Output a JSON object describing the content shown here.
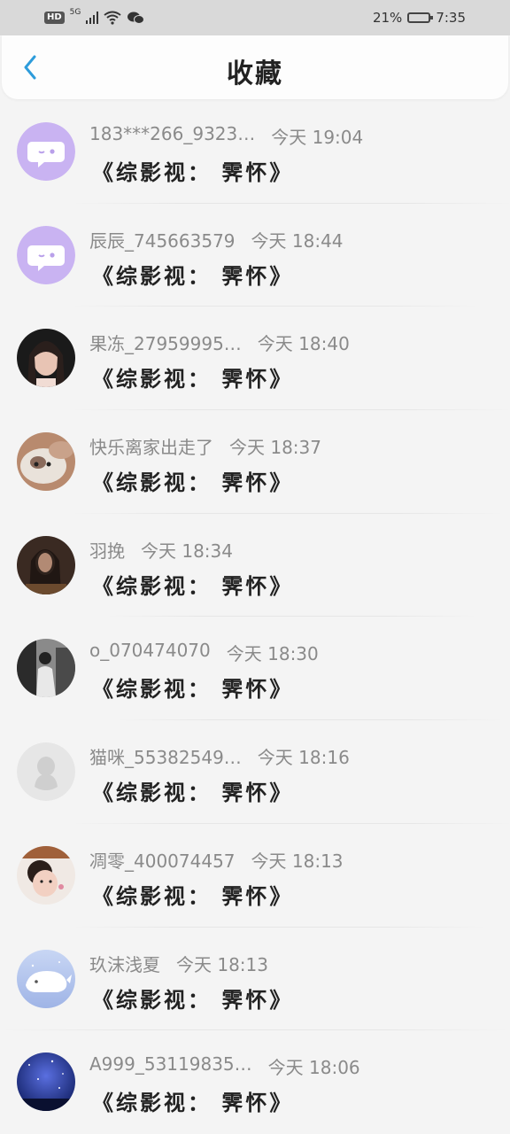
{
  "status_bar": {
    "hd": "HD",
    "network": "5G",
    "battery_percent": "21%",
    "time": "7:35",
    "battery_level": 0.21
  },
  "header": {
    "back_icon": "chevron-left-icon",
    "title": "收藏"
  },
  "colors": {
    "accent": "#2d9cdb",
    "purple_avatar": "#c9b3f2"
  },
  "items": [
    {
      "name": "183***266_9323…",
      "time": "今天 19:04",
      "content": "《综影视： 霁怀》",
      "avatar": "purple-chat-avatar"
    },
    {
      "name": "辰辰_745663579",
      "time": "今天 18:44",
      "content": "《综影视： 霁怀》",
      "avatar": "purple-chat-avatar"
    },
    {
      "name": "果冻_27959995…",
      "time": "今天 18:40",
      "content": "《综影视： 霁怀》",
      "avatar": "girl-portrait-avatar"
    },
    {
      "name": "快乐离家出走了",
      "time": "今天 18:37",
      "content": "《综影视： 霁怀》",
      "avatar": "kitten-avatar"
    },
    {
      "name": "羽挽",
      "time": "今天 18:34",
      "content": "《综影视： 霁怀》",
      "avatar": "dark-portrait-avatar"
    },
    {
      "name": "o_070474070",
      "time": "今天 18:30",
      "content": "《综影视： 霁怀》",
      "avatar": "bw-photo-avatar"
    },
    {
      "name": "猫咪_55382549…",
      "time": "今天 18:16",
      "content": "《综影视： 霁怀》",
      "avatar": "default-penguin-avatar"
    },
    {
      "name": "凋零_400074457",
      "time": "今天 18:13",
      "content": "《综影视： 霁怀》",
      "avatar": "child-photo-avatar"
    },
    {
      "name": "玖沫浅夏",
      "time": "今天 18:13",
      "content": "《综影视： 霁怀》",
      "avatar": "whale-cartoon-avatar"
    },
    {
      "name": "A999_53119835…",
      "time": "今天 18:06",
      "content": "《综影视： 霁怀》",
      "avatar": "starry-sky-avatar"
    }
  ]
}
